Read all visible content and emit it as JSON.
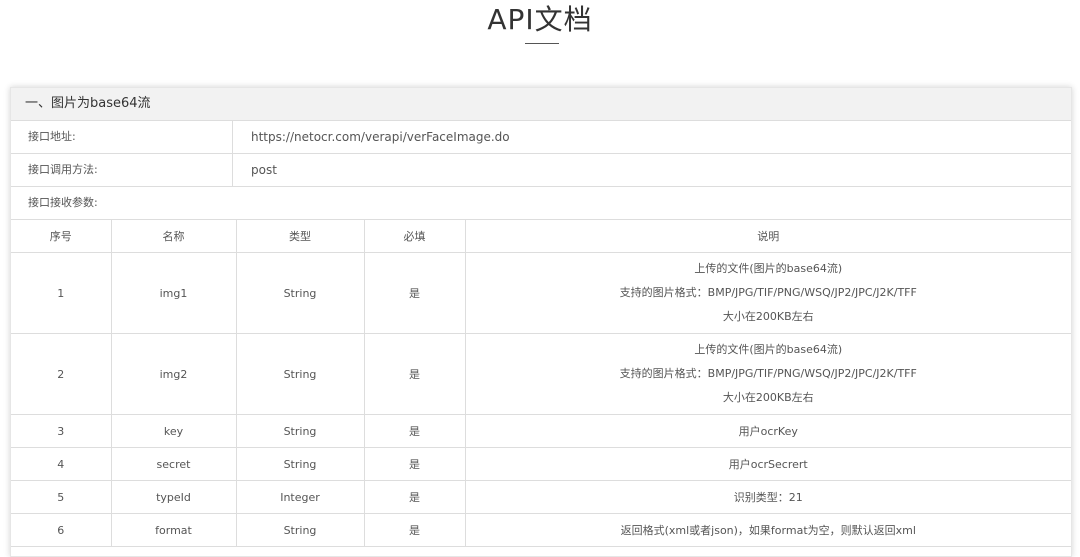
{
  "page": {
    "title": "API文档"
  },
  "section": {
    "title": "一、图片为base64流",
    "endpoint_label": "接口地址:",
    "endpoint_value": "https://netocr.com/verapi/verFaceImage.do",
    "method_label": "接口调用方法:",
    "method_value": "post",
    "params_label": "接口接收参数:"
  },
  "table": {
    "headers": [
      "序号",
      "名称",
      "类型",
      "必填",
      "说明"
    ],
    "rows": [
      {
        "index": "1",
        "name": "img1",
        "type": "String",
        "required": "是",
        "desc": [
          "上传的文件(图片的base64流)",
          "支持的图片格式：BMP/JPG/TIF/PNG/WSQ/JP2/JPC/J2K/TFF",
          "大小在200KB左右"
        ]
      },
      {
        "index": "2",
        "name": "img2",
        "type": "String",
        "required": "是",
        "desc": [
          "上传的文件(图片的base64流)",
          "支持的图片格式：BMP/JPG/TIF/PNG/WSQ/JP2/JPC/J2K/TFF",
          "大小在200KB左右"
        ]
      },
      {
        "index": "3",
        "name": "key",
        "type": "String",
        "required": "是",
        "desc": [
          "用户ocrKey"
        ]
      },
      {
        "index": "4",
        "name": "secret",
        "type": "String",
        "required": "是",
        "desc": [
          "用户ocrSecrert"
        ]
      },
      {
        "index": "5",
        "name": "typeId",
        "type": "Integer",
        "required": "是",
        "desc": [
          "识别类型：21"
        ]
      },
      {
        "index": "6",
        "name": "format",
        "type": "String",
        "required": "是",
        "desc": [
          "返回格式(xml或者json)，如果format为空，则默认返回xml"
        ]
      }
    ]
  }
}
